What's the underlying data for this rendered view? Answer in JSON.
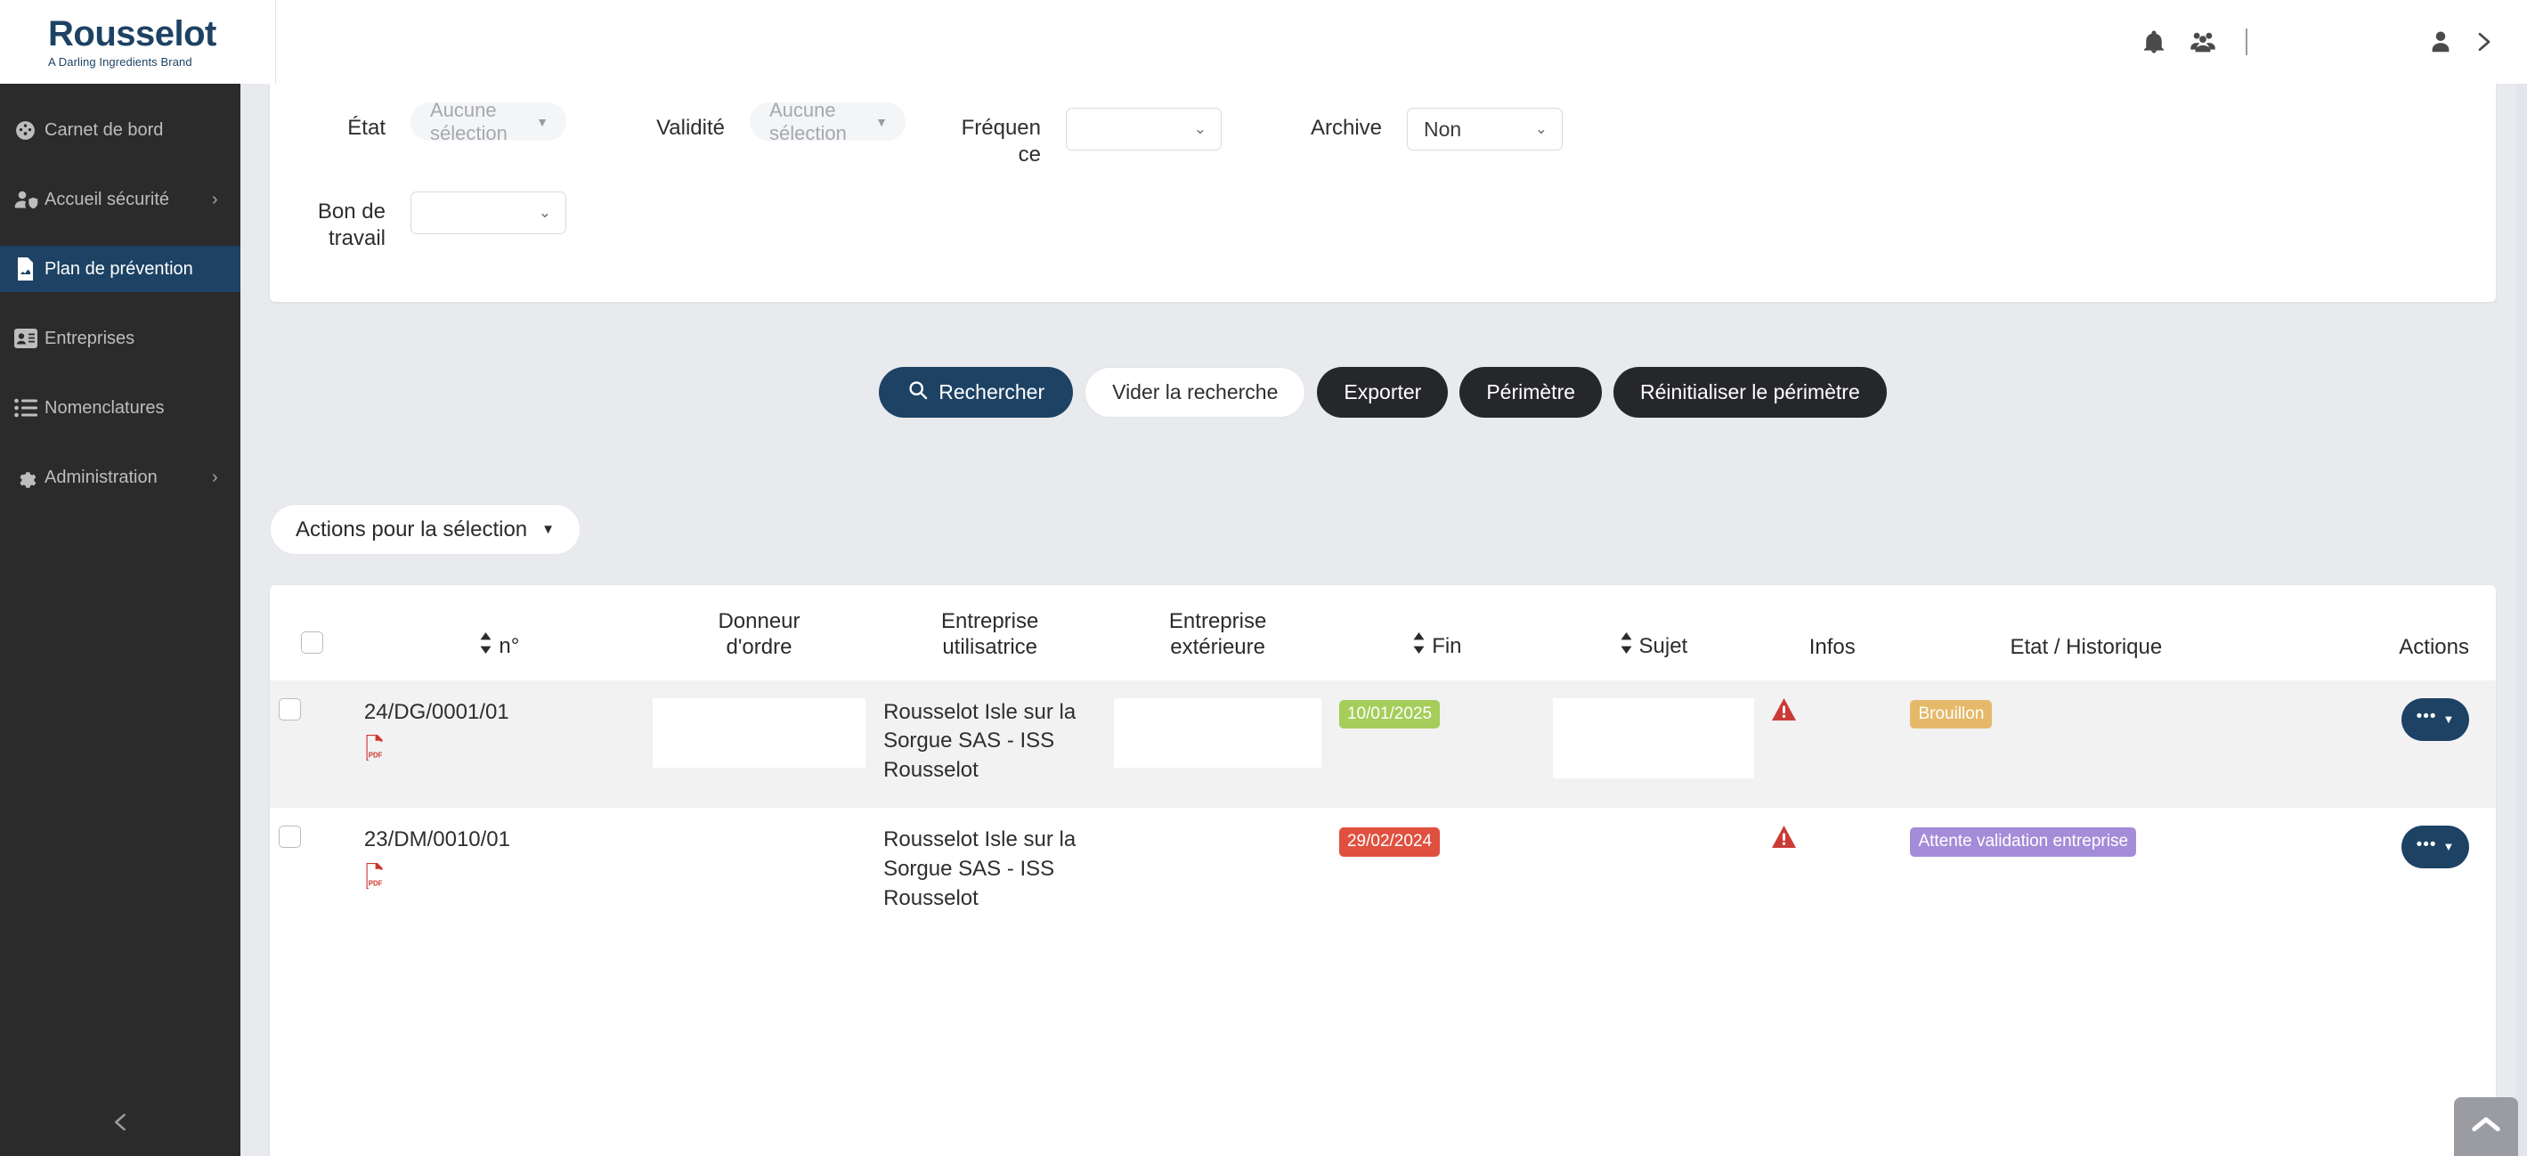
{
  "brand": {
    "name": "Rousselot",
    "tagline": "A Darling Ingredients Brand"
  },
  "topbar": {
    "bell_icon": "bell-icon",
    "team_icon": "users-group-icon",
    "account_icon": "person-icon",
    "expand_icon": "chevron-right-icon"
  },
  "sidebar": {
    "items": [
      {
        "label": "Carnet de bord",
        "icon": "dashboard-speedometer-icon",
        "active": false,
        "caret": ""
      },
      {
        "label": "Accueil sécurité",
        "icon": "user-shield-icon",
        "active": false,
        "caret": "›"
      },
      {
        "label": "Plan de prévention",
        "icon": "document-chart-icon",
        "active": true,
        "caret": ""
      },
      {
        "label": "Entreprises",
        "icon": "id-card-icon",
        "active": false,
        "caret": ""
      },
      {
        "label": "Nomenclatures",
        "icon": "list-icon",
        "active": false,
        "caret": ""
      },
      {
        "label": "Administration",
        "icon": "gear-icon",
        "active": false,
        "caret": "›"
      }
    ],
    "collapse_icon": "chevron-left-icon"
  },
  "filters": {
    "etat": {
      "label": "État",
      "value": "Aucune sélection",
      "caret": "▼"
    },
    "validite": {
      "label": "Validité",
      "value": "Aucune sélection",
      "caret": "▼"
    },
    "frequence": {
      "label": "Fréquen ce",
      "label_l1": "Fréquen",
      "label_l2": "ce",
      "value": "",
      "chev": "⌄"
    },
    "archive": {
      "label": "Archive",
      "value": "Non",
      "chev": "⌄"
    },
    "bon_de_travail": {
      "label_l1": "Bon de",
      "label_l2": "travail",
      "value": "",
      "chev": "⌄"
    }
  },
  "buttons": {
    "rechercher": "Rechercher",
    "search_icon": "search-icon",
    "vider": "Vider la recherche",
    "exporter": "Exporter",
    "perimetre": "Périmètre",
    "reinit": "Réinitialiser le périmètre"
  },
  "selection": {
    "label": "Actions pour la sélection",
    "caret": "▼"
  },
  "table": {
    "sort_icon": "sort-updown-icon",
    "headers": {
      "num": "n°",
      "donneur": "Donneur d'ordre",
      "donneur_l1": "Donneur",
      "donneur_l2": "d'ordre",
      "eut_l1": "Entreprise",
      "eut_l2": "utilisatrice",
      "eex_l1": "Entreprise",
      "eex_l2": "extérieure",
      "fin": "Fin",
      "sujet": "Sujet",
      "infos": "Infos",
      "etat_hist": "Etat / Historique",
      "actions": "Actions"
    },
    "rows": [
      {
        "numero": "24/DG/0001/01",
        "pdf_icon": "pdf-file-icon",
        "donneur": "",
        "entreprise_utilisatrice": "Rousselot Isle sur la Sorgue SAS - ISS Rousselot",
        "entreprise_exterieure": "",
        "fin": "10/01/2025",
        "fin_color": "#a5cd5a",
        "sujet": "",
        "infos_icon": "warning-triangle-icon",
        "etat": "Brouillon",
        "etat_color": "#e5b969",
        "action_icon": "ellipsis-dropdown-icon"
      },
      {
        "numero": "23/DM/0010/01",
        "pdf_icon": "pdf-file-icon",
        "donneur": "",
        "entreprise_utilisatrice": "Rousselot Isle sur la Sorgue SAS - ISS Rousselot",
        "entreprise_exterieure": "",
        "fin": "29/02/2024",
        "fin_color": "#e0503f",
        "sujet": "",
        "infos_icon": "warning-triangle-icon",
        "etat": "Attente validation entreprise",
        "etat_color": "#a58cd8",
        "action_icon": "ellipsis-dropdown-icon"
      }
    ]
  },
  "scroll_top": {
    "icon": "chevron-up-icon"
  },
  "colors": {
    "brand_blue": "#1d4264",
    "sidebar_bg": "#2b2b2b",
    "page_bg": "#e9eaee",
    "dark_button": "#26272b"
  }
}
